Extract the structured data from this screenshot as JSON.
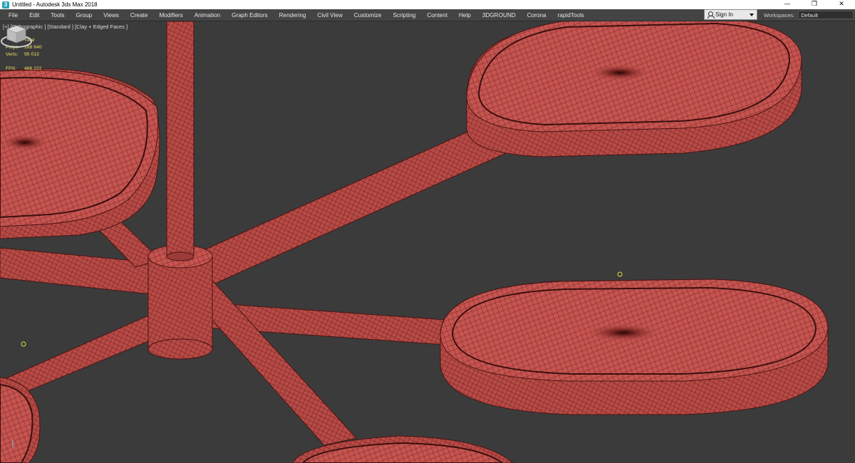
{
  "window": {
    "title": "Untitled - Autodesk 3ds Max 2018",
    "controls": [
      "—",
      "❐",
      "✕"
    ]
  },
  "menu": [
    "File",
    "Edit",
    "Tools",
    "Group",
    "Views",
    "Create",
    "Modifiers",
    "Animation",
    "Graph Editors",
    "Rendering",
    "Civil View",
    "Customize",
    "Scripting",
    "Content",
    "Help",
    "3DGROUND",
    "Corona",
    "rapidTools"
  ],
  "signin": {
    "label": "Sign In"
  },
  "workspaces": {
    "label": "Workspaces:",
    "value": "Default"
  },
  "viewport": {
    "label": "[+] [Orthographic ] [Standard ] [Clay + Edged Faces ]",
    "stats": {
      "header": "Total",
      "polys_label": "Polys:",
      "polys_value": "188 640",
      "verts_label": "Verts:",
      "verts_value": "95 013",
      "fps_label": "FPS:",
      "fps_value": "466.222"
    }
  },
  "colors": {
    "mesh_fill": "#c65450",
    "mesh_wire": "#5a1a18",
    "viewport_bg": "#3b3b3b",
    "stats_text": "#e8e06a"
  },
  "icons": {
    "app": "3ds-max-icon",
    "user": "user-icon",
    "viewcube": "viewcube-icon"
  }
}
